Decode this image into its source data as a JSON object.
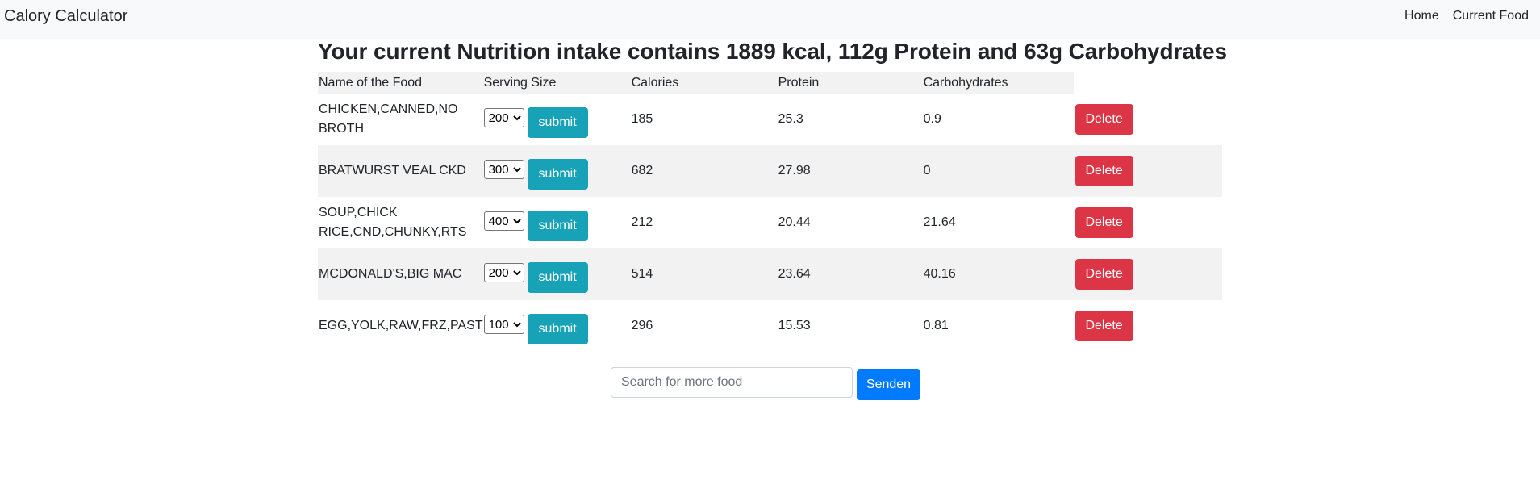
{
  "navbar": {
    "brand": "Calory Calculator",
    "links": [
      "Home",
      "Current Food"
    ]
  },
  "summary": {
    "heading": "Your current Nutrition intake contains 1889 kcal, 112g Protein and 63g Carbohydrates"
  },
  "table": {
    "headers": [
      "Name of the Food",
      "Serving Size",
      "Calories",
      "Protein",
      "Carbohydrates"
    ],
    "rows": [
      {
        "name": "CHICKEN,CANNED,NO BROTH",
        "serving": "200",
        "calories": "185",
        "protein": "25.3",
        "carbs": "0.9"
      },
      {
        "name": "BRATWURST VEAL CKD",
        "serving": "300",
        "calories": "682",
        "protein": "27.98",
        "carbs": "0"
      },
      {
        "name": "SOUP,CHICK RICE,CND,CHUNKY,RTS",
        "serving": "400",
        "calories": "212",
        "protein": "20.44",
        "carbs": "21.64"
      },
      {
        "name": "MCDONALD'S,BIG MAC",
        "serving": "200",
        "calories": "514",
        "protein": "23.64",
        "carbs": "40.16"
      },
      {
        "name": "EGG,YOLK,RAW,FRZ,PAST",
        "serving": "100",
        "calories": "296",
        "protein": "15.53",
        "carbs": "0.81"
      }
    ],
    "submit_label": "submit",
    "delete_label": "Delete"
  },
  "search": {
    "placeholder": "Search for more food",
    "value": "",
    "button_label": "Senden"
  },
  "colors": {
    "submit": "#17a2b8",
    "delete": "#dc3545",
    "send": "#007bff",
    "navbar_bg": "#f8f9fa",
    "stripe_bg": "#f2f2f2"
  }
}
